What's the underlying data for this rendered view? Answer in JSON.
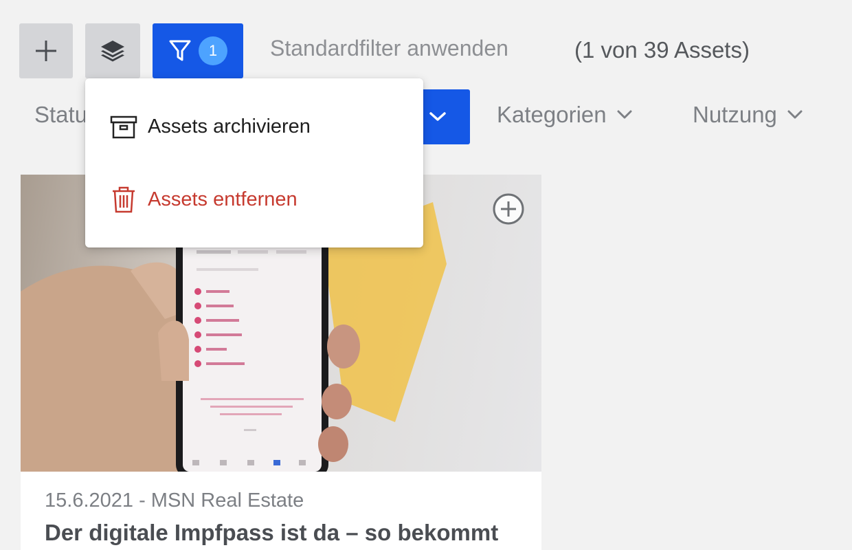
{
  "toolbar": {
    "filter_count": "1",
    "standard_filter_label": "Standardfilter anwenden",
    "asset_count_label": "(1 von 39 Assets)"
  },
  "filters": {
    "status_label": "Statu",
    "kategorien_label": "Kategorien",
    "nutzung_label": "Nutzung"
  },
  "menu": {
    "items": [
      {
        "label": "Assets archivieren",
        "icon": "archive-icon"
      },
      {
        "label": "Assets entfernen",
        "icon": "trash-icon"
      }
    ]
  },
  "card": {
    "meta": "15.6.2021 - MSN Real Estate",
    "title": "Der digitale Impfpass ist da – so bekommt"
  },
  "colors": {
    "accent": "#1558e6",
    "badge": "#4da3ff",
    "danger": "#c63a2f",
    "toolbar_button": "#d4d5d8"
  }
}
